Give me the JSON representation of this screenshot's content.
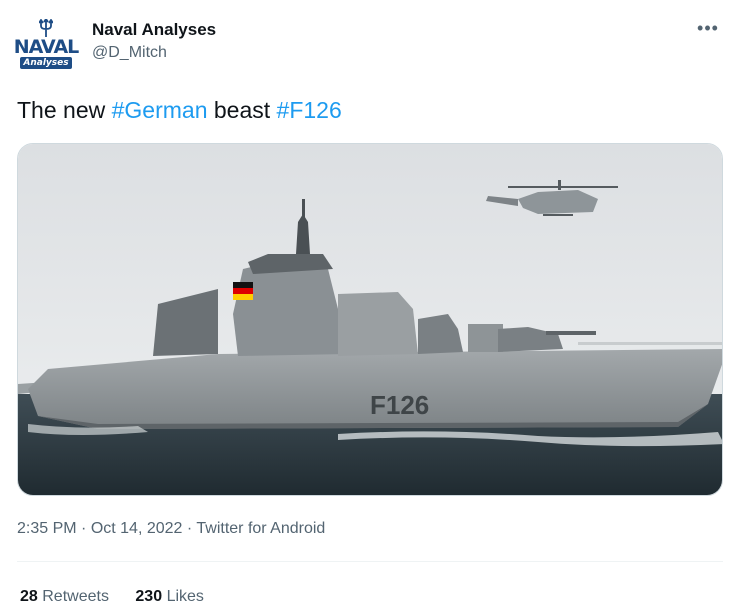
{
  "author": {
    "display_name": "Naval Analyses",
    "handle": "@D_Mitch",
    "avatar_text_top": "NAVAL",
    "avatar_text_bottom": "Analyses"
  },
  "more_icon": "more-horizontal-icon",
  "tweet": {
    "text_prefix": "The new ",
    "hashtag_1": "#German",
    "text_middle": " beast ",
    "hashtag_2": "#F126"
  },
  "media": {
    "hull_marking": "F126",
    "sky_color": "#e6e8ea",
    "hull_color": "#8f9598",
    "sea_color": "#2f3d45"
  },
  "meta": {
    "time": "2:35 PM",
    "separator": " · ",
    "date": "Oct 14, 2022",
    "source": "Twitter for Android"
  },
  "stats": {
    "retweets_count": "28",
    "retweets_label": "Retweets",
    "likes_count": "230",
    "likes_label": "Likes"
  },
  "colors": {
    "link": "#1d9bf0",
    "secondary_text": "#536471",
    "primary_text": "#0f1419"
  }
}
